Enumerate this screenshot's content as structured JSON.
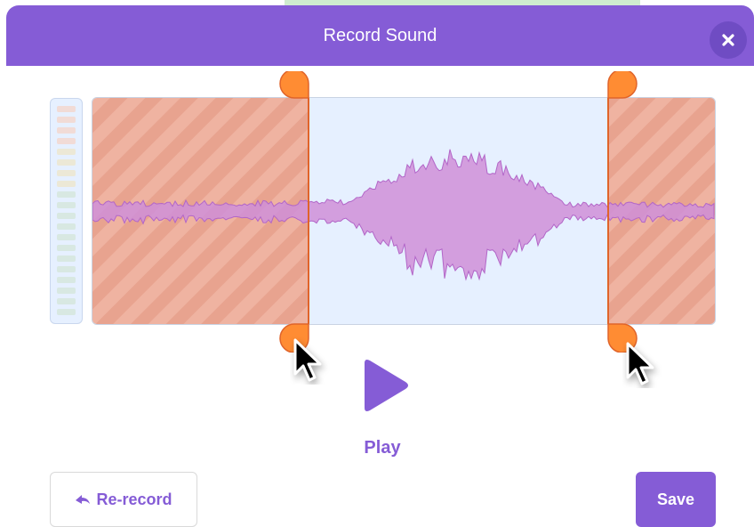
{
  "dialog": {
    "title": "Record Sound"
  },
  "controls": {
    "play_label": "Play",
    "rerecord_label": "Re-record",
    "save_label": "Save"
  },
  "icons": {
    "close": "close-icon",
    "play": "play-icon",
    "rerecord": "undo-arrow-icon",
    "trim_handle": "trim-handle-icon",
    "cursor": "mouse-pointer-icon"
  },
  "colors": {
    "brand_purple": "#855cd6",
    "header_close_bg": "#6f4cc3",
    "trim_orange": "#ff8c33",
    "trimmed_overlay": "#e8a38f",
    "waveform_fill": "#cf8fd8",
    "canvas_bg": "#e6f0ff"
  }
}
